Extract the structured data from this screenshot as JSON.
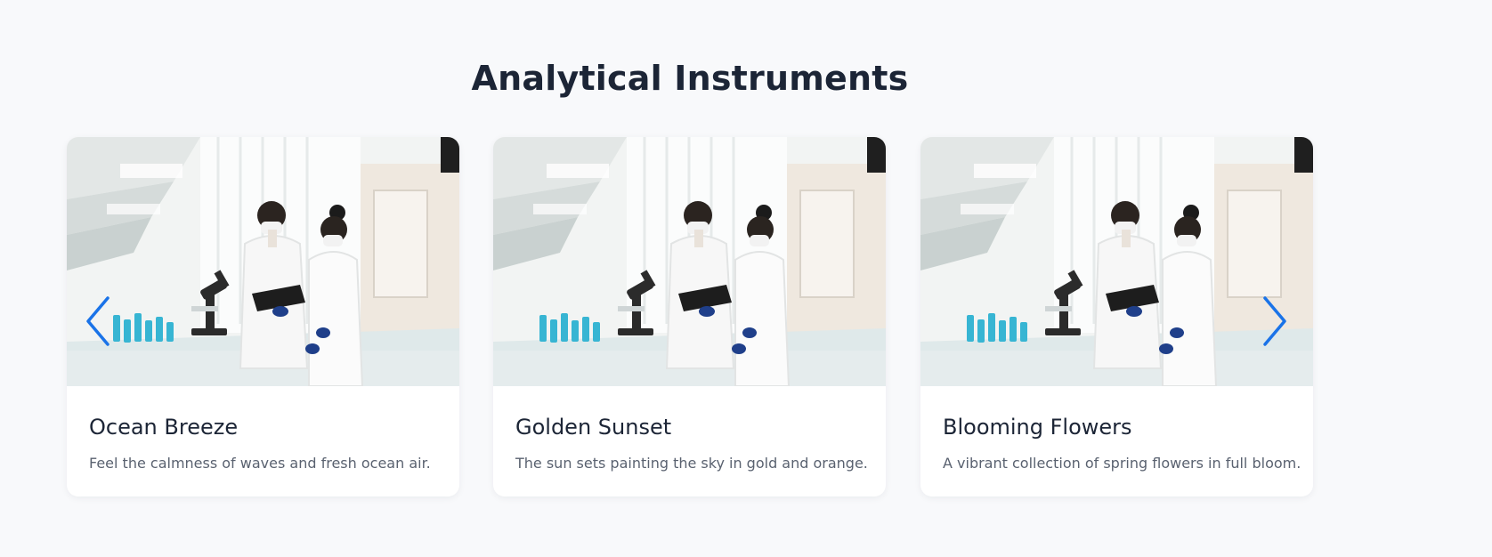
{
  "section": {
    "title": "Analytical Instruments"
  },
  "carousel": {
    "prev_icon": "chevron-left-icon",
    "next_icon": "chevron-right-icon",
    "accent_color": "#1a73e8",
    "cards": [
      {
        "title": "Ocean Breeze",
        "description": "Feel the calmness of waves and fresh ocean air."
      },
      {
        "title": "Golden Sunset",
        "description": "The sun sets painting the sky in gold and orange."
      },
      {
        "title": "Blooming Flowers",
        "description": "A vibrant collection of spring flowers in full bloom."
      }
    ]
  }
}
